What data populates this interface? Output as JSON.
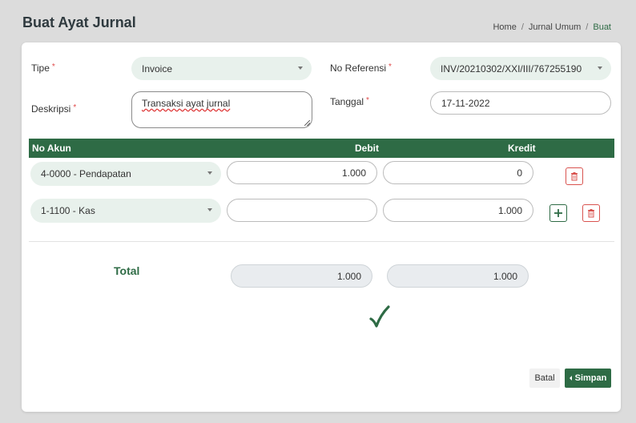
{
  "header": {
    "title": "Buat Ayat Jurnal",
    "breadcrumb": [
      "Home",
      "Jurnal Umum",
      "Buat"
    ]
  },
  "form": {
    "tipe_label": "Tipe",
    "tipe_value": "Invoice",
    "noref_label": "No Referensi",
    "noref_value": "INV/20210302/XXI/III/767255190",
    "deskripsi_label": "Deskripsi",
    "deskripsi_value": "Transaksi ayat jurnal",
    "tanggal_label": "Tanggal",
    "tanggal_value": "17-11-2022",
    "required_mark": "*"
  },
  "table": {
    "headers": [
      "No Akun",
      "Debit",
      "Kredit"
    ],
    "rows": [
      {
        "akun": "4-0000 - Pendapatan",
        "debit": "1.000",
        "kredit": "0"
      },
      {
        "akun": "1-1100 - Kas",
        "debit": "",
        "kredit": "1.000"
      }
    ]
  },
  "totals": {
    "label": "Total",
    "debit": "1.000",
    "kredit": "1.000"
  },
  "actions": {
    "batal": "Batal",
    "simpan": "Simpan"
  },
  "colors": {
    "primary": "#2e6b45",
    "danger": "#d9534f",
    "select_bg": "#e8f1ec"
  },
  "icons": {
    "delete": "trash-icon",
    "add": "plus-icon",
    "balanced": "checkmark-icon"
  }
}
